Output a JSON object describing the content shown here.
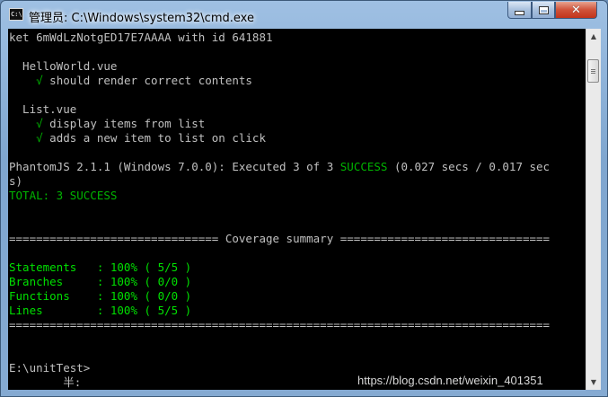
{
  "window": {
    "title": "管理员: C:\\Windows\\system32\\cmd.exe",
    "icon": "cmd-icon",
    "icon_text": "C:\\"
  },
  "controls": {
    "minimize": "minimize-icon",
    "maximize": "maximize-icon",
    "close": "close-icon",
    "close_glyph": "✕"
  },
  "console": {
    "line_ket": "ket 6mWdLzNotgED17E7AAAA with id 641881",
    "hello_file": "  HelloWorld.vue",
    "hello_test_1_check": "    √",
    "hello_test_1_text": " should render correct contents",
    "list_file": "  List.vue",
    "list_test_1_check": "    √",
    "list_test_1_text": " display items from list",
    "list_test_2_check": "    √",
    "list_test_2_text": " adds a new item to list on click",
    "phantom_prefix": "PhantomJS 2.1.1 (Windows 7.0.0): Executed 3 of 3 ",
    "phantom_success": "SUCCESS",
    "phantom_suffix": " (0.027 secs / 0.017 sec",
    "phantom_wrap": "s)",
    "total_line": "TOTAL: 3 SUCCESS",
    "coverage_header": "=============================== Coverage summary ===============================",
    "coverage_rows": [
      "Statements   : 100% ( 5/5 )",
      "Branches     : 100% ( 0/0 )",
      "Functions    : 100% ( 0/0 )",
      "Lines        : 100% ( 5/5 )"
    ],
    "coverage_footer": "================================================================================",
    "prompt": "E:\\unitTest>",
    "ime_indicator": "        半:"
  },
  "watermark": "https://blog.csdn.net/weixin_401351",
  "colors": {
    "console_bg": "#000000",
    "text": "#c0c0c0",
    "success_green": "#00b400",
    "coverage_green": "#00e000"
  }
}
